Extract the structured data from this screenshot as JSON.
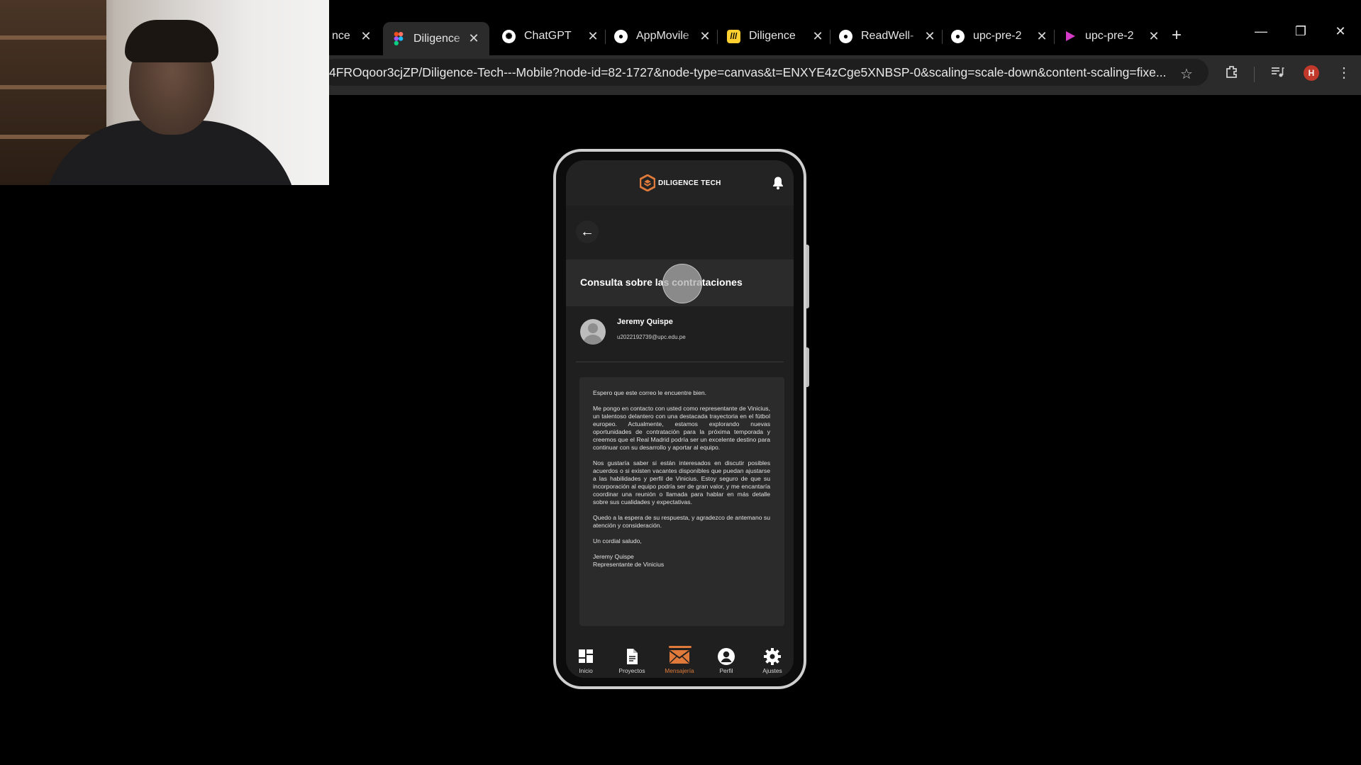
{
  "browser": {
    "tabs": [
      {
        "label": "nce",
        "favicon": "partial-tab",
        "active": false
      },
      {
        "label": "Diligence",
        "favicon": "figma-icon",
        "active": true
      },
      {
        "label": "ChatGPT",
        "favicon": "chatgpt-icon",
        "active": false
      },
      {
        "label": "AppMovile",
        "favicon": "github-icon",
        "active": false
      },
      {
        "label": "Diligence",
        "favicon": "miro-icon",
        "active": false
      },
      {
        "label": "ReadWell-",
        "favicon": "github-icon",
        "active": false
      },
      {
        "label": "upc-pre-2",
        "favicon": "github-icon",
        "active": false
      },
      {
        "label": "upc-pre-2",
        "favicon": "canva-icon",
        "active": false
      }
    ],
    "url": "4FROqoor3cjZP/Diligence-Tech---Mobile?node-id=82-1727&node-type=canvas&t=ENXYE4zCge5XNBSP-0&scaling=scale-down&content-scaling=fixe...",
    "profile_initial": "H",
    "colors": {
      "accent": "#e07a3a",
      "tab_bg": "#2b2b2b",
      "page_bg": "#000000"
    }
  },
  "app": {
    "brand": "DILIGENCE TECH",
    "subject": "Consulta sobre las contrataciones",
    "sender_name": "Jeremy Quispe",
    "sender_email": "u2022192739@upc.edu.pe",
    "body": {
      "p1": "Espero que este correo le encuentre bien.",
      "p2": "Me pongo en contacto con usted como representante de Vinicius, un talentoso delantero con una destacada trayectoria en el fútbol europeo. Actualmente, estamos explorando nuevas oportunidades de contratación para la próxima temporada y creemos que el Real Madrid podría ser un excelente destino para continuar con su desarrollo y aportar al equipo.",
      "p3": "Nos gustaría saber si están interesados en discutir posibles acuerdos o si existen vacantes disponibles que puedan ajustarse a las habilidades y perfil de Vinicius. Estoy seguro de que su incorporación al equipo podría ser de gran valor, y me encantaría coordinar una reunión o llamada para hablar en más detalle sobre sus cualidades y expectativas.",
      "p4": "Quedo a la espera de su respuesta, y agradezco de antemano su atención y consideración.",
      "p5": "Un cordial saludo,",
      "sig_name": "Jeremy Quispe",
      "sig_role": "Representante de Vinicius"
    },
    "nav": [
      {
        "label": "Inicio",
        "icon": "dashboard-icon"
      },
      {
        "label": "Proyectos",
        "icon": "document-icon"
      },
      {
        "label": "Mensajería",
        "icon": "mail-icon",
        "active": true
      },
      {
        "label": "Perfil",
        "icon": "user-icon"
      },
      {
        "label": "Ajustes",
        "icon": "gear-icon"
      }
    ]
  }
}
